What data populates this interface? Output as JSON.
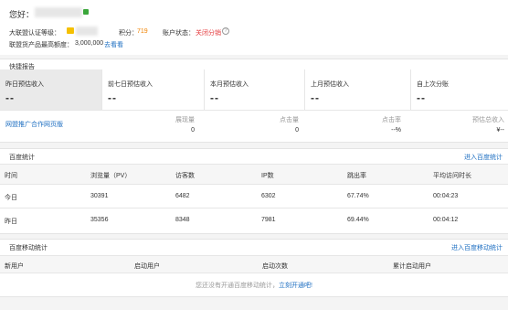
{
  "header": {
    "greeting": "您好：",
    "level_label": "大联盟认证等级：",
    "points_label": "积分：",
    "points_value": "719",
    "status_label": "账户状态：",
    "status_value": "关闭分销",
    "help_icon": "question-circle-icon",
    "limit_label": "联盟货产品最高额度：",
    "limit_value": "3,000,000",
    "limit_link": "去看看"
  },
  "quick_report": {
    "title": "快捷报告",
    "cells": [
      {
        "label": "昨日预估收入",
        "value": "--"
      },
      {
        "label": "前七日预估收入",
        "value": "--"
      },
      {
        "label": "本月预估收入",
        "value": "--"
      },
      {
        "label": "上月预估收入",
        "value": "--"
      },
      {
        "label": "自上次分账",
        "value": "--"
      }
    ],
    "site_link": "网盟推广合作网页版",
    "metrics": [
      {
        "label": "展现量",
        "value": "0"
      },
      {
        "label": "点击量",
        "value": "0"
      },
      {
        "label": "点击率",
        "value": "--%"
      },
      {
        "label": "预估总收入",
        "value": "¥--"
      }
    ]
  },
  "baidu_stats": {
    "title": "百度统计",
    "link": "进入百度统计",
    "columns": [
      "时间",
      "浏览量（PV）",
      "访客数",
      "IP数",
      "跳出率",
      "平均访问时长"
    ],
    "rows": [
      [
        "今日",
        "30391",
        "6482",
        "6302",
        "67.74%",
        "00:04:23"
      ],
      [
        "昨日",
        "35356",
        "8348",
        "7981",
        "69.44%",
        "00:04:12"
      ]
    ]
  },
  "mobile_stats": {
    "title": "百度移动统计",
    "link": "进入百度移动统计",
    "columns": [
      "新用户",
      "启动用户",
      "启动次数",
      "累计启动用户"
    ],
    "empty_text": "您还没有开通百度移动统计，",
    "empty_link": "立刻开通吧!"
  },
  "colors": {
    "link": "#1e6fc2",
    "points": "#f08200",
    "status": "#e4393c",
    "active_cell": "#eaeaea"
  }
}
